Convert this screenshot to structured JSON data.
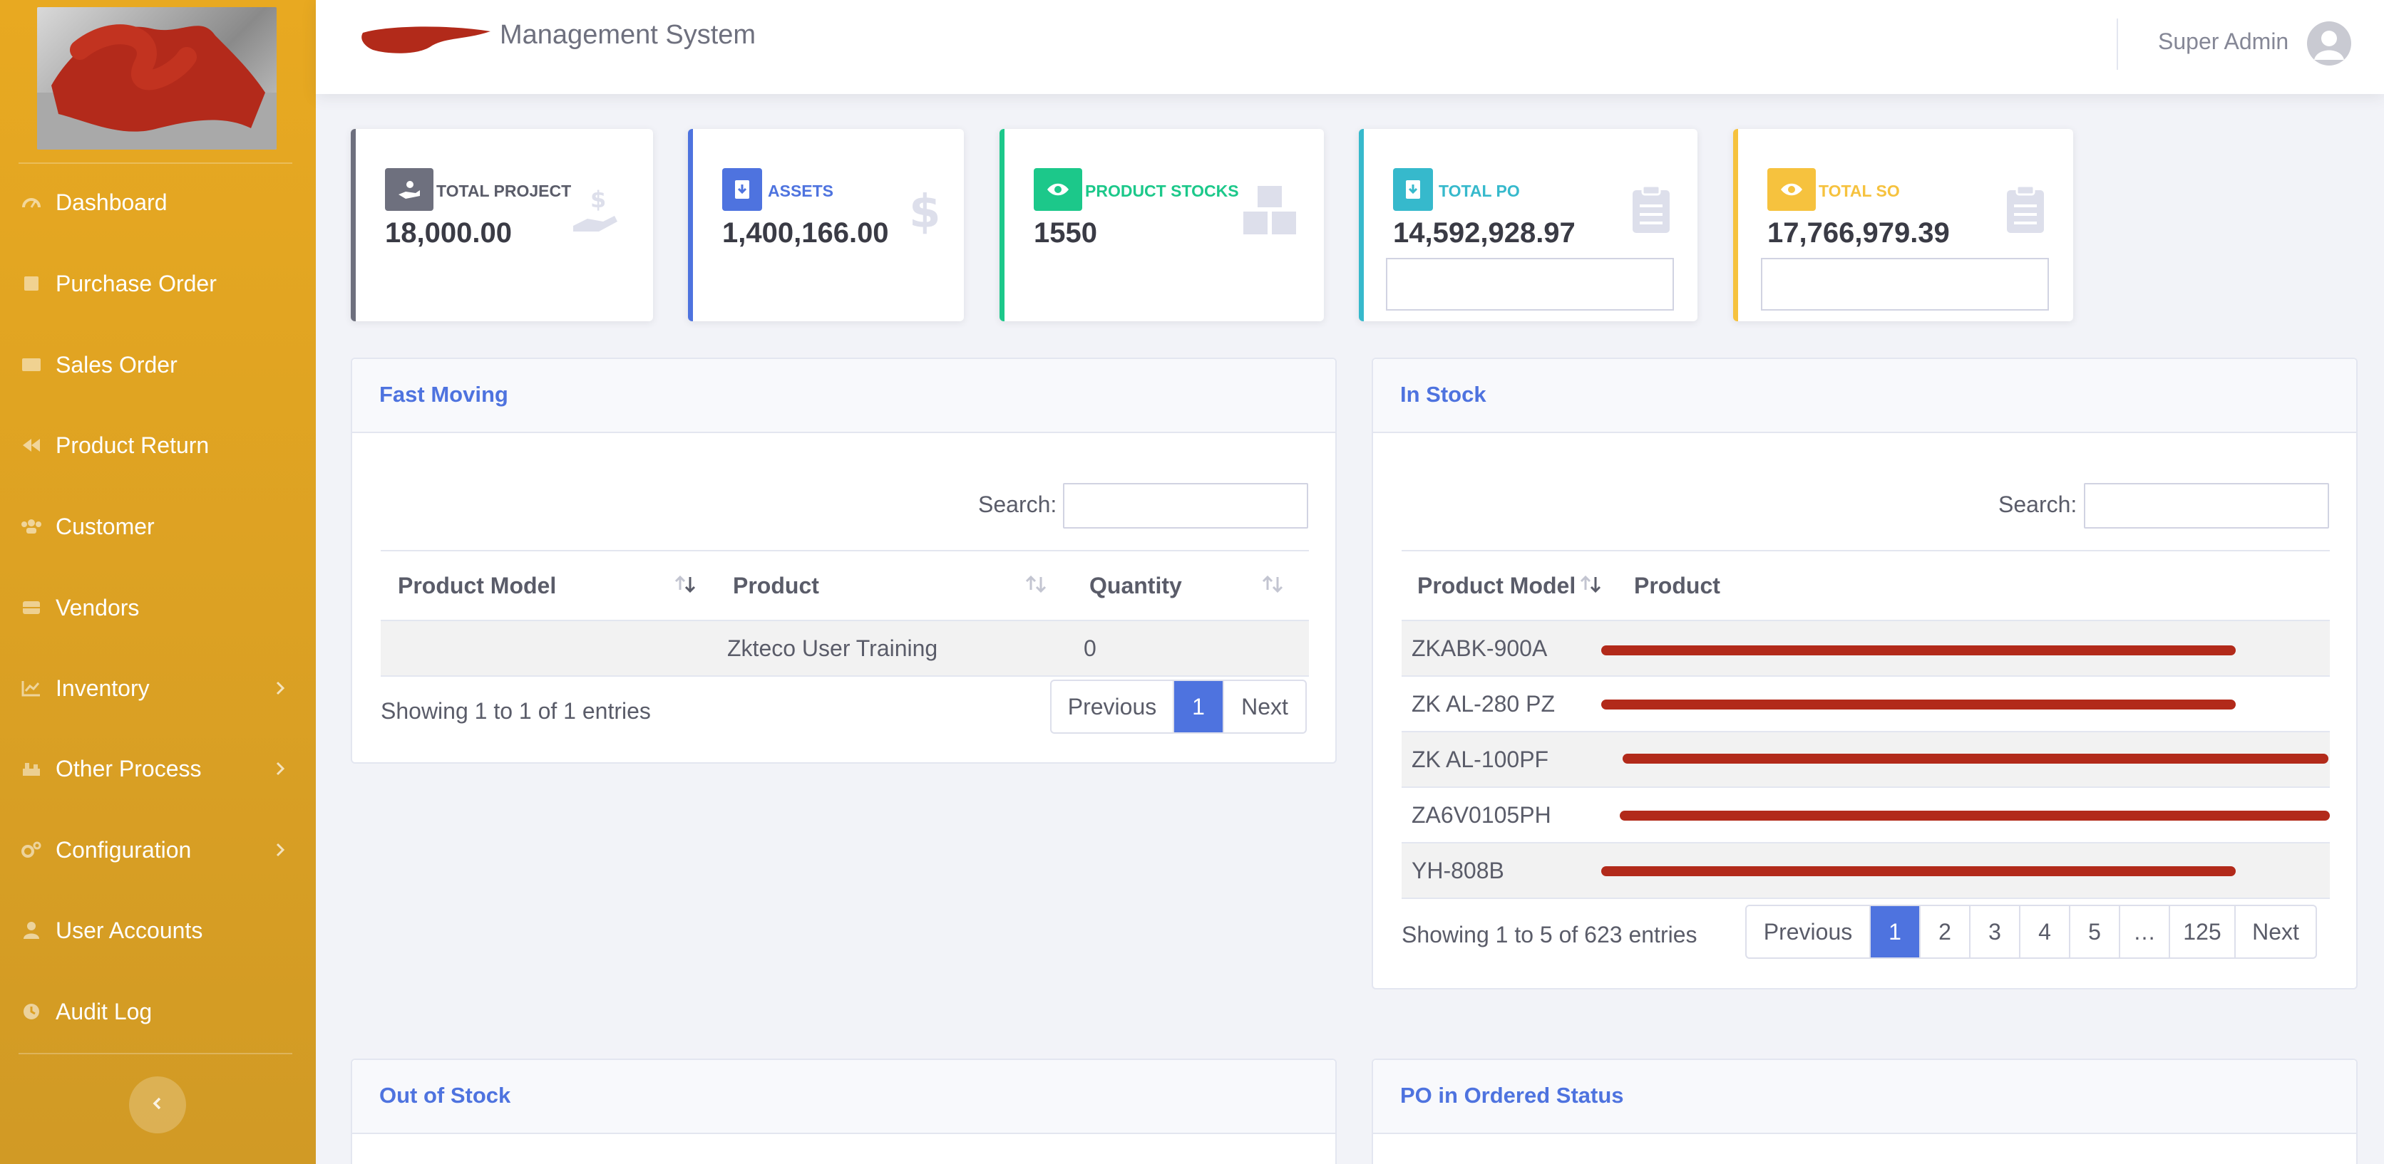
{
  "app": {
    "title_suffix": "Management System"
  },
  "user": {
    "name": "Super Admin"
  },
  "sidebar": {
    "items": [
      {
        "label": "Dashboard",
        "icon": "dashboard-icon"
      },
      {
        "label": "Purchase Order",
        "icon": "purchase-order-icon"
      },
      {
        "label": "Sales Order",
        "icon": "sales-order-icon"
      },
      {
        "label": "Product Return",
        "icon": "product-return-icon"
      },
      {
        "label": "Customer",
        "icon": "customer-icon"
      },
      {
        "label": "Vendors",
        "icon": "vendors-icon"
      },
      {
        "label": "Inventory",
        "icon": "inventory-icon",
        "has_submenu": true
      },
      {
        "label": "Other Process",
        "icon": "other-process-icon",
        "has_submenu": true
      },
      {
        "label": "Configuration",
        "icon": "configuration-icon",
        "has_submenu": true
      },
      {
        "label": "User Accounts",
        "icon": "user-accounts-icon"
      },
      {
        "label": "Audit Log",
        "icon": "audit-log-icon"
      }
    ],
    "collapse_icon": "chevron-left-icon"
  },
  "stats": [
    {
      "label": "TOTAL PROJECT",
      "value": "18,000.00",
      "color": "#6e707e"
    },
    {
      "label": "ASSETS",
      "value": "1,400,166.00",
      "color": "#4e73df"
    },
    {
      "label": "PRODUCT STOCKS",
      "value": "1550",
      "color": "#1cc88a"
    },
    {
      "label": "TOTAL PO",
      "value": "14,592,928.97",
      "color": "#36b9cc"
    },
    {
      "label": "TOTAL SO",
      "value": "17,766,979.39",
      "color": "#f6c23e"
    }
  ],
  "fast_moving": {
    "title": "Fast Moving",
    "search_label": "Search:",
    "columns": [
      "Product Model",
      "Product",
      "Quantity"
    ],
    "rows": [
      {
        "model": "",
        "product": "Zkteco User Training",
        "quantity": "0"
      }
    ],
    "info": "Showing 1 to 1 of 1 entries",
    "pagination": {
      "previous": "Previous",
      "pages": [
        "1"
      ],
      "next": "Next",
      "current": "1"
    }
  },
  "in_stock": {
    "title": "In Stock",
    "search_label": "Search:",
    "columns": [
      "Product Model",
      "Product"
    ],
    "rows": [
      {
        "model": "ZKABK-900A"
      },
      {
        "model": "ZK AL-280 PZ"
      },
      {
        "model": "ZK AL-100PF"
      },
      {
        "model": "ZA6V0105PH"
      },
      {
        "model": "YH-808B"
      }
    ],
    "info": "Showing 1 to 5 of 623 entries",
    "pagination": {
      "previous": "Previous",
      "pages": [
        "1",
        "2",
        "3",
        "4",
        "5",
        "…",
        "125"
      ],
      "next": "Next",
      "current": "1"
    }
  },
  "out_of_stock": {
    "title": "Out of Stock"
  },
  "po_ordered": {
    "title": "PO in Ordered Status"
  }
}
